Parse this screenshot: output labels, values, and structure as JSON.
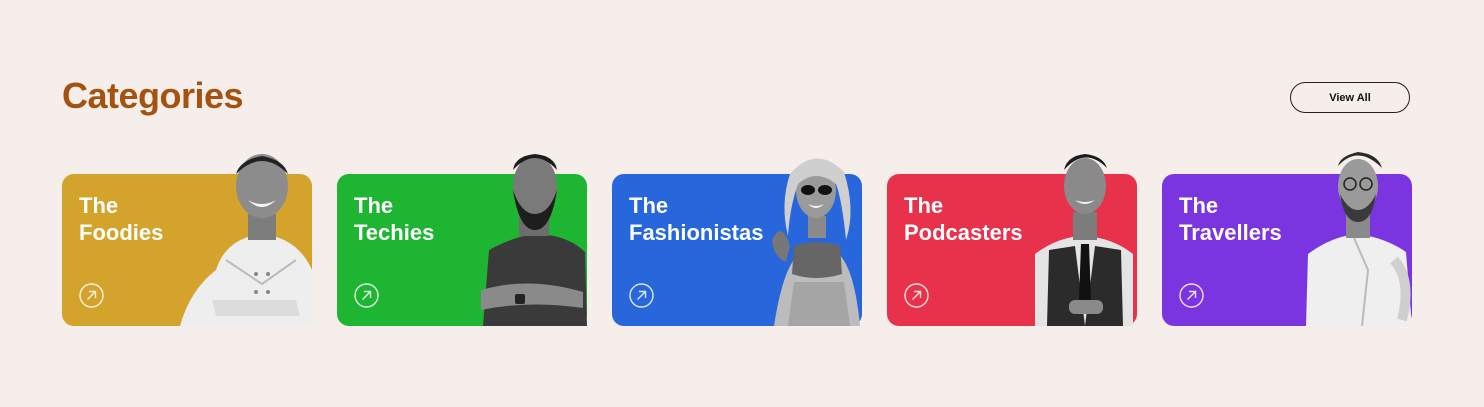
{
  "section": {
    "title": "Categories",
    "view_all_label": "View All"
  },
  "categories": [
    {
      "line1": "The",
      "line2": "Foodies",
      "color": "#d4a32b"
    },
    {
      "line1": "The",
      "line2": "Techies",
      "color": "#1eb533"
    },
    {
      "line1": "The",
      "line2": "Fashionistas",
      "color": "#2766db"
    },
    {
      "line1": "The",
      "line2": "Podcasters",
      "color": "#e8314a"
    },
    {
      "line1": "The",
      "line2": "Travellers",
      "color": "#7b35e0"
    }
  ],
  "icons": {
    "card_link": "arrow-up-right-circle-icon"
  }
}
